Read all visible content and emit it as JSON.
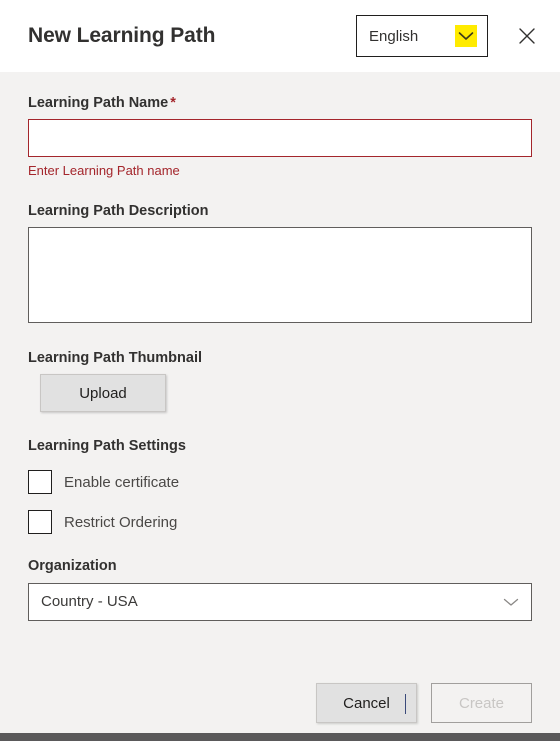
{
  "header": {
    "title": "New Learning Path",
    "language_selector": {
      "value": "English",
      "icon": "chevron-down-icon",
      "highlight_color": "#ffeb00"
    },
    "close_icon": "close-icon"
  },
  "form": {
    "name_field": {
      "label": "Learning Path Name",
      "required_marker": "*",
      "value": "",
      "placeholder": "",
      "error_message": "Enter Learning Path name",
      "error_color": "#a4262c",
      "has_error": true
    },
    "description_field": {
      "label": "Learning Path Description",
      "value": "",
      "placeholder": ""
    },
    "thumbnail_field": {
      "label": "Learning Path Thumbnail",
      "upload_label": "Upload"
    },
    "settings": {
      "label": "Learning Path Settings",
      "options": [
        {
          "label": "Enable certificate",
          "checked": false
        },
        {
          "label": "Restrict Ordering",
          "checked": false
        }
      ]
    },
    "organization_field": {
      "label": "Organization",
      "value": "Country - USA",
      "icon": "chevron-down-icon"
    }
  },
  "footer": {
    "cancel_label": "Cancel",
    "create_label": "Create",
    "create_disabled": true
  }
}
